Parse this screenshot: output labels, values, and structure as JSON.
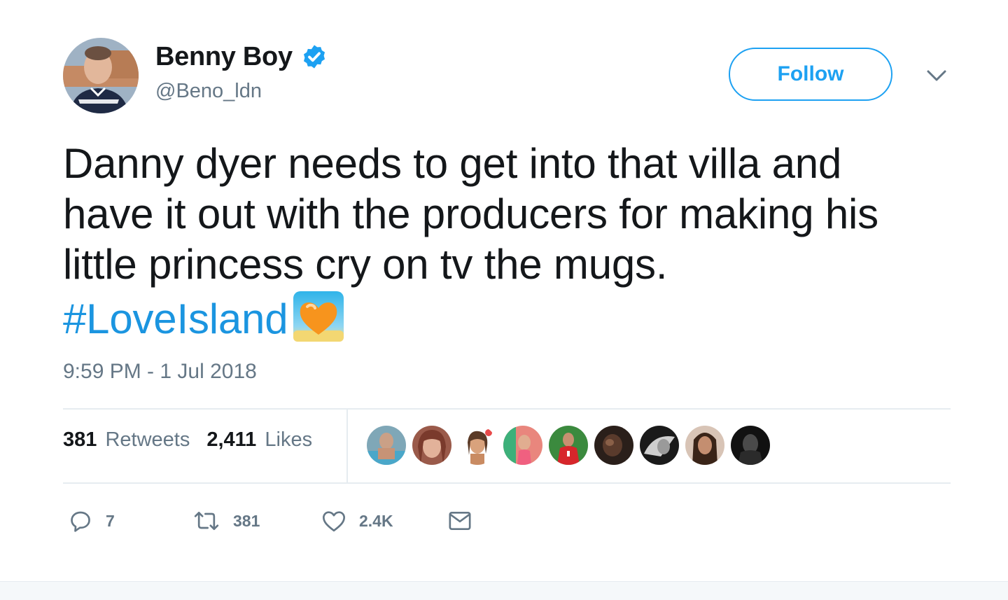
{
  "author": {
    "display_name": "Benny Boy",
    "handle": "@Beno_ldn",
    "verified": true
  },
  "follow_button_label": "Follow",
  "tweet": {
    "lines": [
      "Danny dyer needs to get into that villa and",
      "have it out with the producers for making his",
      "little princess cry on tv the mugs."
    ],
    "hashtag": "#LoveIsland",
    "hashflag_icon": "orange-heart-island-icon",
    "timestamp": "9:59 PM - 1 Jul 2018"
  },
  "stats": {
    "retweets_count": "381",
    "retweets_label": "Retweets",
    "likes_count": "2,411",
    "likes_label": "Likes"
  },
  "actions": {
    "reply_count": "7",
    "retweet_count": "381",
    "like_count": "2.4K"
  },
  "colors": {
    "link_blue": "#1da1f2",
    "hashtag_blue": "#1b95e0",
    "secondary_gray": "#657786",
    "text": "#14171a",
    "divider": "#e6ecf0"
  }
}
